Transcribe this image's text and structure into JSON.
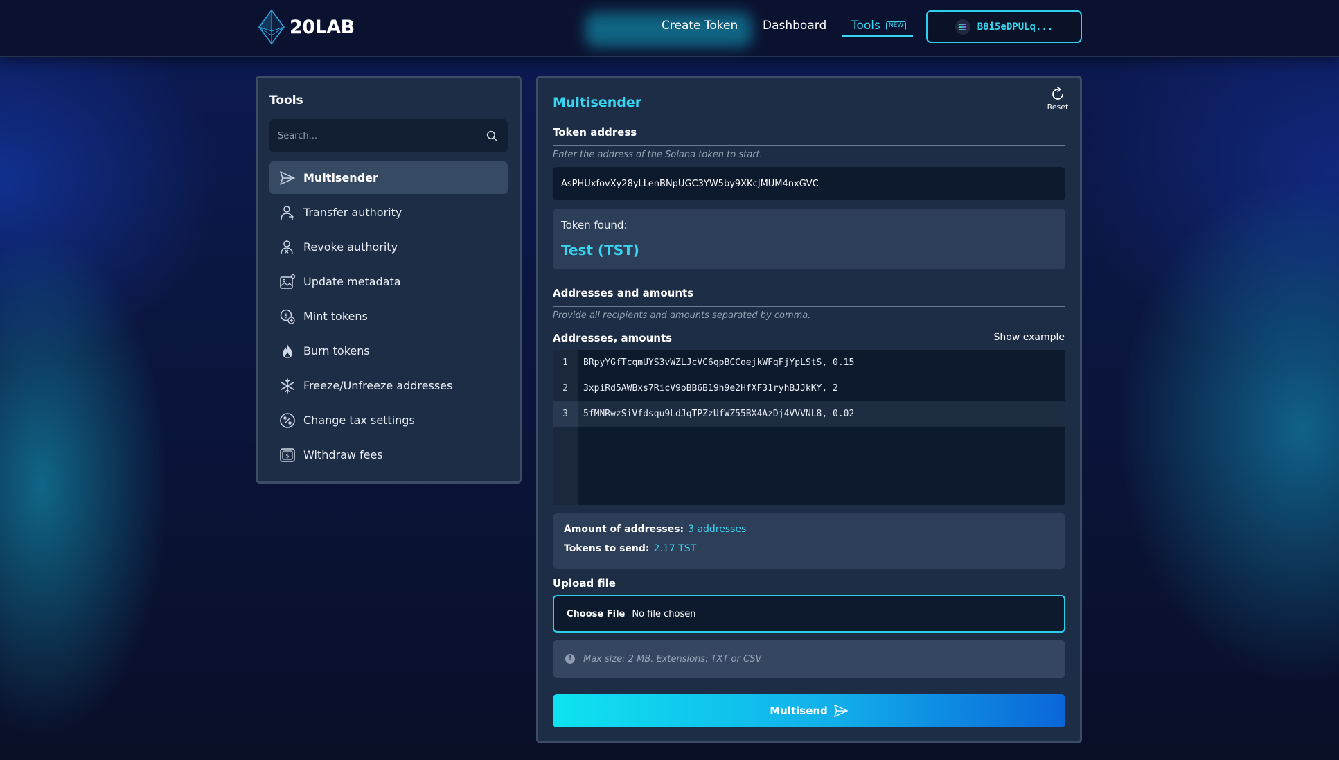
{
  "header": {
    "brand": "20LAB",
    "nav": {
      "create_token": "Create Token",
      "dashboard": "Dashboard",
      "tools": "Tools",
      "tools_badge": "NEW"
    },
    "wallet": "B8i5eDPULq..."
  },
  "sidebar": {
    "title": "Tools",
    "search_placeholder": "Search...",
    "items": [
      {
        "label": "Multisender",
        "icon": "send-icon",
        "active": true
      },
      {
        "label": "Transfer authority",
        "icon": "user-transfer-icon"
      },
      {
        "label": "Revoke authority",
        "icon": "user-revoke-icon"
      },
      {
        "label": "Update metadata",
        "icon": "image-edit-icon"
      },
      {
        "label": "Mint tokens",
        "icon": "coin-plus-icon"
      },
      {
        "label": "Burn tokens",
        "icon": "flame-icon"
      },
      {
        "label": "Freeze/Unfreeze addresses",
        "icon": "snowflake-icon"
      },
      {
        "label": "Change tax settings",
        "icon": "percent-icon"
      },
      {
        "label": "Withdraw fees",
        "icon": "withdraw-icon"
      }
    ]
  },
  "main": {
    "title": "Multisender",
    "reset_label": "Reset",
    "token_address": {
      "label": "Token address",
      "hint": "Enter the address of the Solana token to start.",
      "value": "AsPHUxfovXy28yLLenBNpUGC3YW5by9XKcJMUM4nxGVC"
    },
    "token_found": {
      "label": "Token found:",
      "value": "Test (TST)"
    },
    "addresses": {
      "section_label": "Addresses and amounts",
      "hint": "Provide all recipients and amounts separated by comma.",
      "field_label": "Addresses, amounts",
      "show_example": "Show example",
      "lines": [
        {
          "num": "1",
          "text": "BRpyYGfTcqmUYS3vWZLJcVC6qpBCCoejkWFqFjYpLStS, 0.15"
        },
        {
          "num": "2",
          "text": "3xpiRd5AWBxs7RicV9oBB6B19h9e2HfXF31ryhBJJkKY, 2"
        },
        {
          "num": "3",
          "text": "5fMNRwzSiVfdsqu9LdJqTPZzUfWZ55BX4AzDj4VVVNL8, 0.02"
        }
      ]
    },
    "stats": {
      "amount_label": "Amount of addresses:",
      "amount_value": "3 addresses",
      "tokens_label": "Tokens to send:",
      "tokens_value": "2.17 TST"
    },
    "upload": {
      "label": "Upload file",
      "choose_file": "Choose File",
      "no_file": "No file chosen",
      "info": "Max size: 2 MB. Extensions: TXT or CSV"
    },
    "submit_label": "Multisend"
  },
  "colors": {
    "accent": "#3ad4f0",
    "panel": "#1d2d45",
    "panel_border": "#3b4c66",
    "button_gradient_start": "#0ee3f0",
    "button_gradient_end": "#0a66d8"
  }
}
